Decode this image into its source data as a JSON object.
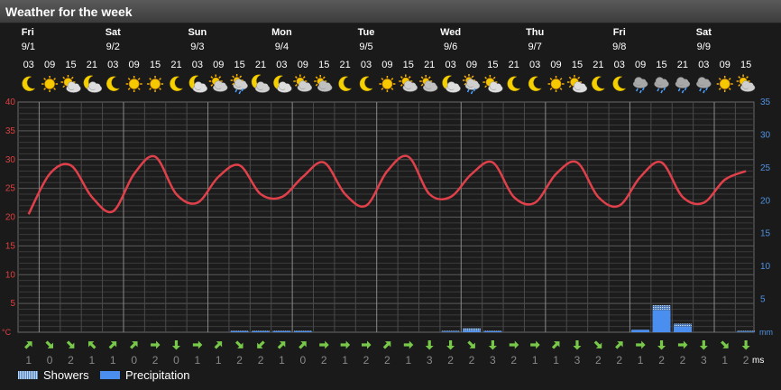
{
  "title": "Weather for the week",
  "days": [
    {
      "name": "Fri",
      "date": "9/1"
    },
    {
      "name": "Sat",
      "date": "9/2"
    },
    {
      "name": "Sun",
      "date": "9/3"
    },
    {
      "name": "Mon",
      "date": "9/4"
    },
    {
      "name": "Tue",
      "date": "9/5"
    },
    {
      "name": "Wed",
      "date": "9/6"
    },
    {
      "name": "Thu",
      "date": "9/7"
    },
    {
      "name": "Fri",
      "date": "9/8"
    },
    {
      "name": "Sat",
      "date": "9/9"
    }
  ],
  "hours": [
    "03",
    "09",
    "15",
    "21",
    "03",
    "09",
    "15",
    "21",
    "03",
    "09",
    "15",
    "21",
    "03",
    "09",
    "15",
    "21",
    "03",
    "09",
    "15",
    "21",
    "03",
    "09",
    "15",
    "21",
    "03",
    "09",
    "15",
    "21",
    "03",
    "09",
    "15",
    "21",
    "03",
    "09",
    "15"
  ],
  "icons": [
    "moon-icon",
    "sun-icon",
    "partly-cloudy-icon",
    "moon-cloudy-icon",
    "moon-icon",
    "sun-icon",
    "sun-icon",
    "moon-icon",
    "moon-cloudy-icon",
    "cloudy-sun-icon",
    "showers-icon",
    "cloudy-moon-icon",
    "moon-cloudy-icon",
    "cloudy-sun-icon",
    "cloudy-icon",
    "moon-icon",
    "moon-icon",
    "sun-icon",
    "cloudy-sun-icon",
    "cloudy-icon",
    "moon-cloudy-icon",
    "showers-icon",
    "partly-cloudy-icon",
    "moon-icon",
    "moon-icon",
    "sun-icon",
    "partly-cloudy-icon",
    "moon-icon",
    "moon-icon",
    "rain-cloud-icon",
    "rain-cloud-icon",
    "rain-cloud-icon",
    "rain-cloud-icon",
    "sun-icon",
    "cloudy-sun-icon"
  ],
  "legend": {
    "showers": "Showers",
    "precipitation": "Precipitation"
  },
  "colors": {
    "temperature": "#e0404a",
    "precipitation": "#4a8ef0",
    "showers": "#a8c8f0",
    "wind": "#78c84a",
    "left_axis": "#e04040",
    "right_axis": "#5090e0",
    "grid": "#5a5a5a"
  },
  "chart_data": {
    "type": "line",
    "x": [
      "9/1 03",
      "9/1 09",
      "9/1 15",
      "9/1 21",
      "9/2 03",
      "9/2 09",
      "9/2 15",
      "9/2 21",
      "9/3 03",
      "9/3 09",
      "9/3 15",
      "9/3 21",
      "9/4 03",
      "9/4 09",
      "9/4 15",
      "9/4 21",
      "9/5 03",
      "9/5 09",
      "9/5 15",
      "9/5 21",
      "9/6 03",
      "9/6 09",
      "9/6 15",
      "9/6 21",
      "9/7 03",
      "9/7 09",
      "9/7 15",
      "9/7 21",
      "9/8 03",
      "9/8 09",
      "9/8 15",
      "9/8 21",
      "9/9 03",
      "9/9 09",
      "9/9 15"
    ],
    "series": [
      {
        "axis": "left",
        "values": [
          20.5,
          27.5,
          29,
          23.5,
          21,
          27.5,
          30.5,
          24,
          22.5,
          27,
          29,
          24,
          23.5,
          27,
          29.5,
          24,
          22,
          28,
          30.5,
          24,
          23.5,
          27.5,
          29.5,
          23.5,
          22.5,
          27.5,
          29.5,
          23.5,
          22,
          27,
          29.5,
          23.5,
          22.5,
          26.5,
          28
        ]
      },
      {
        "name": "Precipitation",
        "axis": "right",
        "values": [
          0,
          0,
          0,
          0,
          0,
          0,
          0,
          0,
          0,
          0,
          0.1,
          0.1,
          0.1,
          0.1,
          0,
          0,
          0,
          0,
          0,
          0,
          0,
          0.2,
          0.1,
          0,
          0,
          0,
          0,
          0,
          0,
          0.3,
          3.3,
          0.8,
          0,
          0,
          0
        ]
      },
      {
        "name": "Showers",
        "axis": "right",
        "values": [
          0,
          0,
          0,
          0,
          0,
          0,
          0,
          0,
          0,
          0,
          0.2,
          0.2,
          0.1,
          0.1,
          0,
          0,
          0,
          0,
          0,
          0,
          0.1,
          0.6,
          0.2,
          0,
          0,
          0,
          0,
          0,
          0,
          0.4,
          4.1,
          1.3,
          0,
          0,
          0.1
        ]
      }
    ],
    "left_axis": {
      "unit": "°C",
      "ticks": [
        "40",
        "35",
        "30",
        "25",
        "20",
        "15",
        "10",
        "5"
      ],
      "ylim": [
        0,
        40
      ]
    },
    "right_axis": {
      "unit": "mm",
      "ticks": [
        "35",
        "30",
        "25",
        "20",
        "15",
        "10",
        "5"
      ],
      "ylim": [
        0,
        35
      ]
    },
    "wind_speed": [
      "1",
      "0",
      "2",
      "1",
      "1",
      "0",
      "2",
      "0",
      "1",
      "1",
      "2",
      "2",
      "1",
      "0",
      "2",
      "1",
      "2",
      "2",
      "1",
      "3",
      "2",
      "2",
      "3",
      "2",
      "1",
      "1",
      "3",
      "2",
      "2",
      "1",
      "2",
      "2",
      "3",
      "1",
      "2"
    ],
    "wind_direction": [
      "ne",
      "se",
      "se",
      "nw",
      "ne",
      "ne",
      "e",
      "s",
      "e",
      "ne",
      "se",
      "sw",
      "ne",
      "ne",
      "e",
      "e",
      "e",
      "ne",
      "e",
      "s",
      "s",
      "se",
      "s",
      "e",
      "e",
      "ne",
      "s",
      "se",
      "ne",
      "e",
      "s",
      "e",
      "s",
      "se",
      "s"
    ],
    "wind_unit": "ms",
    "grid": true
  }
}
